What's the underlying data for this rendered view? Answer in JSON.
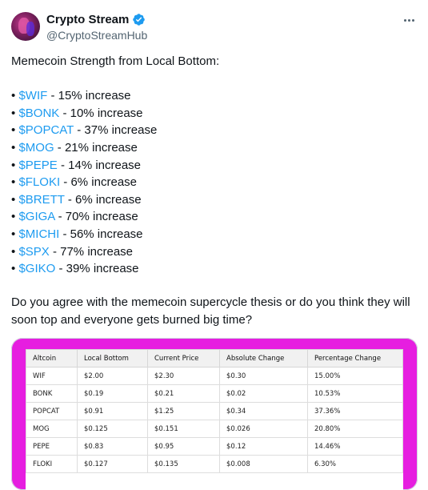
{
  "author": {
    "display_name": "Crypto Stream",
    "handle": "@CryptoStreamHub"
  },
  "icons": {
    "verified": "verified-badge-icon",
    "more": "more-options-icon"
  },
  "colors": {
    "link": "#1d9bf0",
    "media_frame": "#e61ee0",
    "verified": "#1d9bf0"
  },
  "post": {
    "intro": "Memecoin Strength from Local Bottom:",
    "items": [
      {
        "bullet": "•",
        "ticker": "$WIF",
        "rest": " - 15% increase"
      },
      {
        "bullet": "•",
        "ticker": "$BONK",
        "rest": " - 10% increase"
      },
      {
        "bullet": "•",
        "ticker": "$POPCAT",
        "rest": " - 37% increase"
      },
      {
        "bullet": "•",
        "ticker": "$MOG",
        "rest": " - 21% increase"
      },
      {
        "bullet": "•",
        "ticker": "$PEPE",
        "rest": " - 14% increase"
      },
      {
        "bullet": "•",
        "ticker": "$FLOKI",
        "rest": " - 6% increase"
      },
      {
        "bullet": "•",
        "ticker": "$BRETT",
        "rest": " - 6% increase"
      },
      {
        "bullet": "•",
        "ticker": "$GIGA",
        "rest": " - 70% increase"
      },
      {
        "bullet": "•",
        "ticker": "$MICHI",
        "rest": " - 56% increase"
      },
      {
        "bullet": "•",
        "ticker": "$SPX",
        "rest": " - 77% increase"
      },
      {
        "bullet": "•",
        "ticker": "$GIKO",
        "rest": " - 39% increase"
      }
    ],
    "question": "Do you agree with the memecoin supercycle thesis or do you think they will soon top and everyone gets burned big time?"
  },
  "table": {
    "headers": [
      "Altcoin",
      "Local Bottom",
      "Current Price",
      "Absolute Change",
      "Percentage Change"
    ],
    "rows": [
      [
        "WIF",
        "$2.00",
        "$2.30",
        "$0.30",
        "15.00%"
      ],
      [
        "BONK",
        "$0.19",
        "$0.21",
        "$0.02",
        "10.53%"
      ],
      [
        "POPCAT",
        "$0.91",
        "$1.25",
        "$0.34",
        "37.36%"
      ],
      [
        "MOG",
        "$0.125",
        "$0.151",
        "$0.026",
        "20.80%"
      ],
      [
        "PEPE",
        "$0.83",
        "$0.95",
        "$0.12",
        "14.46%"
      ],
      [
        "FLOKI",
        "$0.127",
        "$0.135",
        "$0.008",
        "6.30%"
      ]
    ]
  }
}
